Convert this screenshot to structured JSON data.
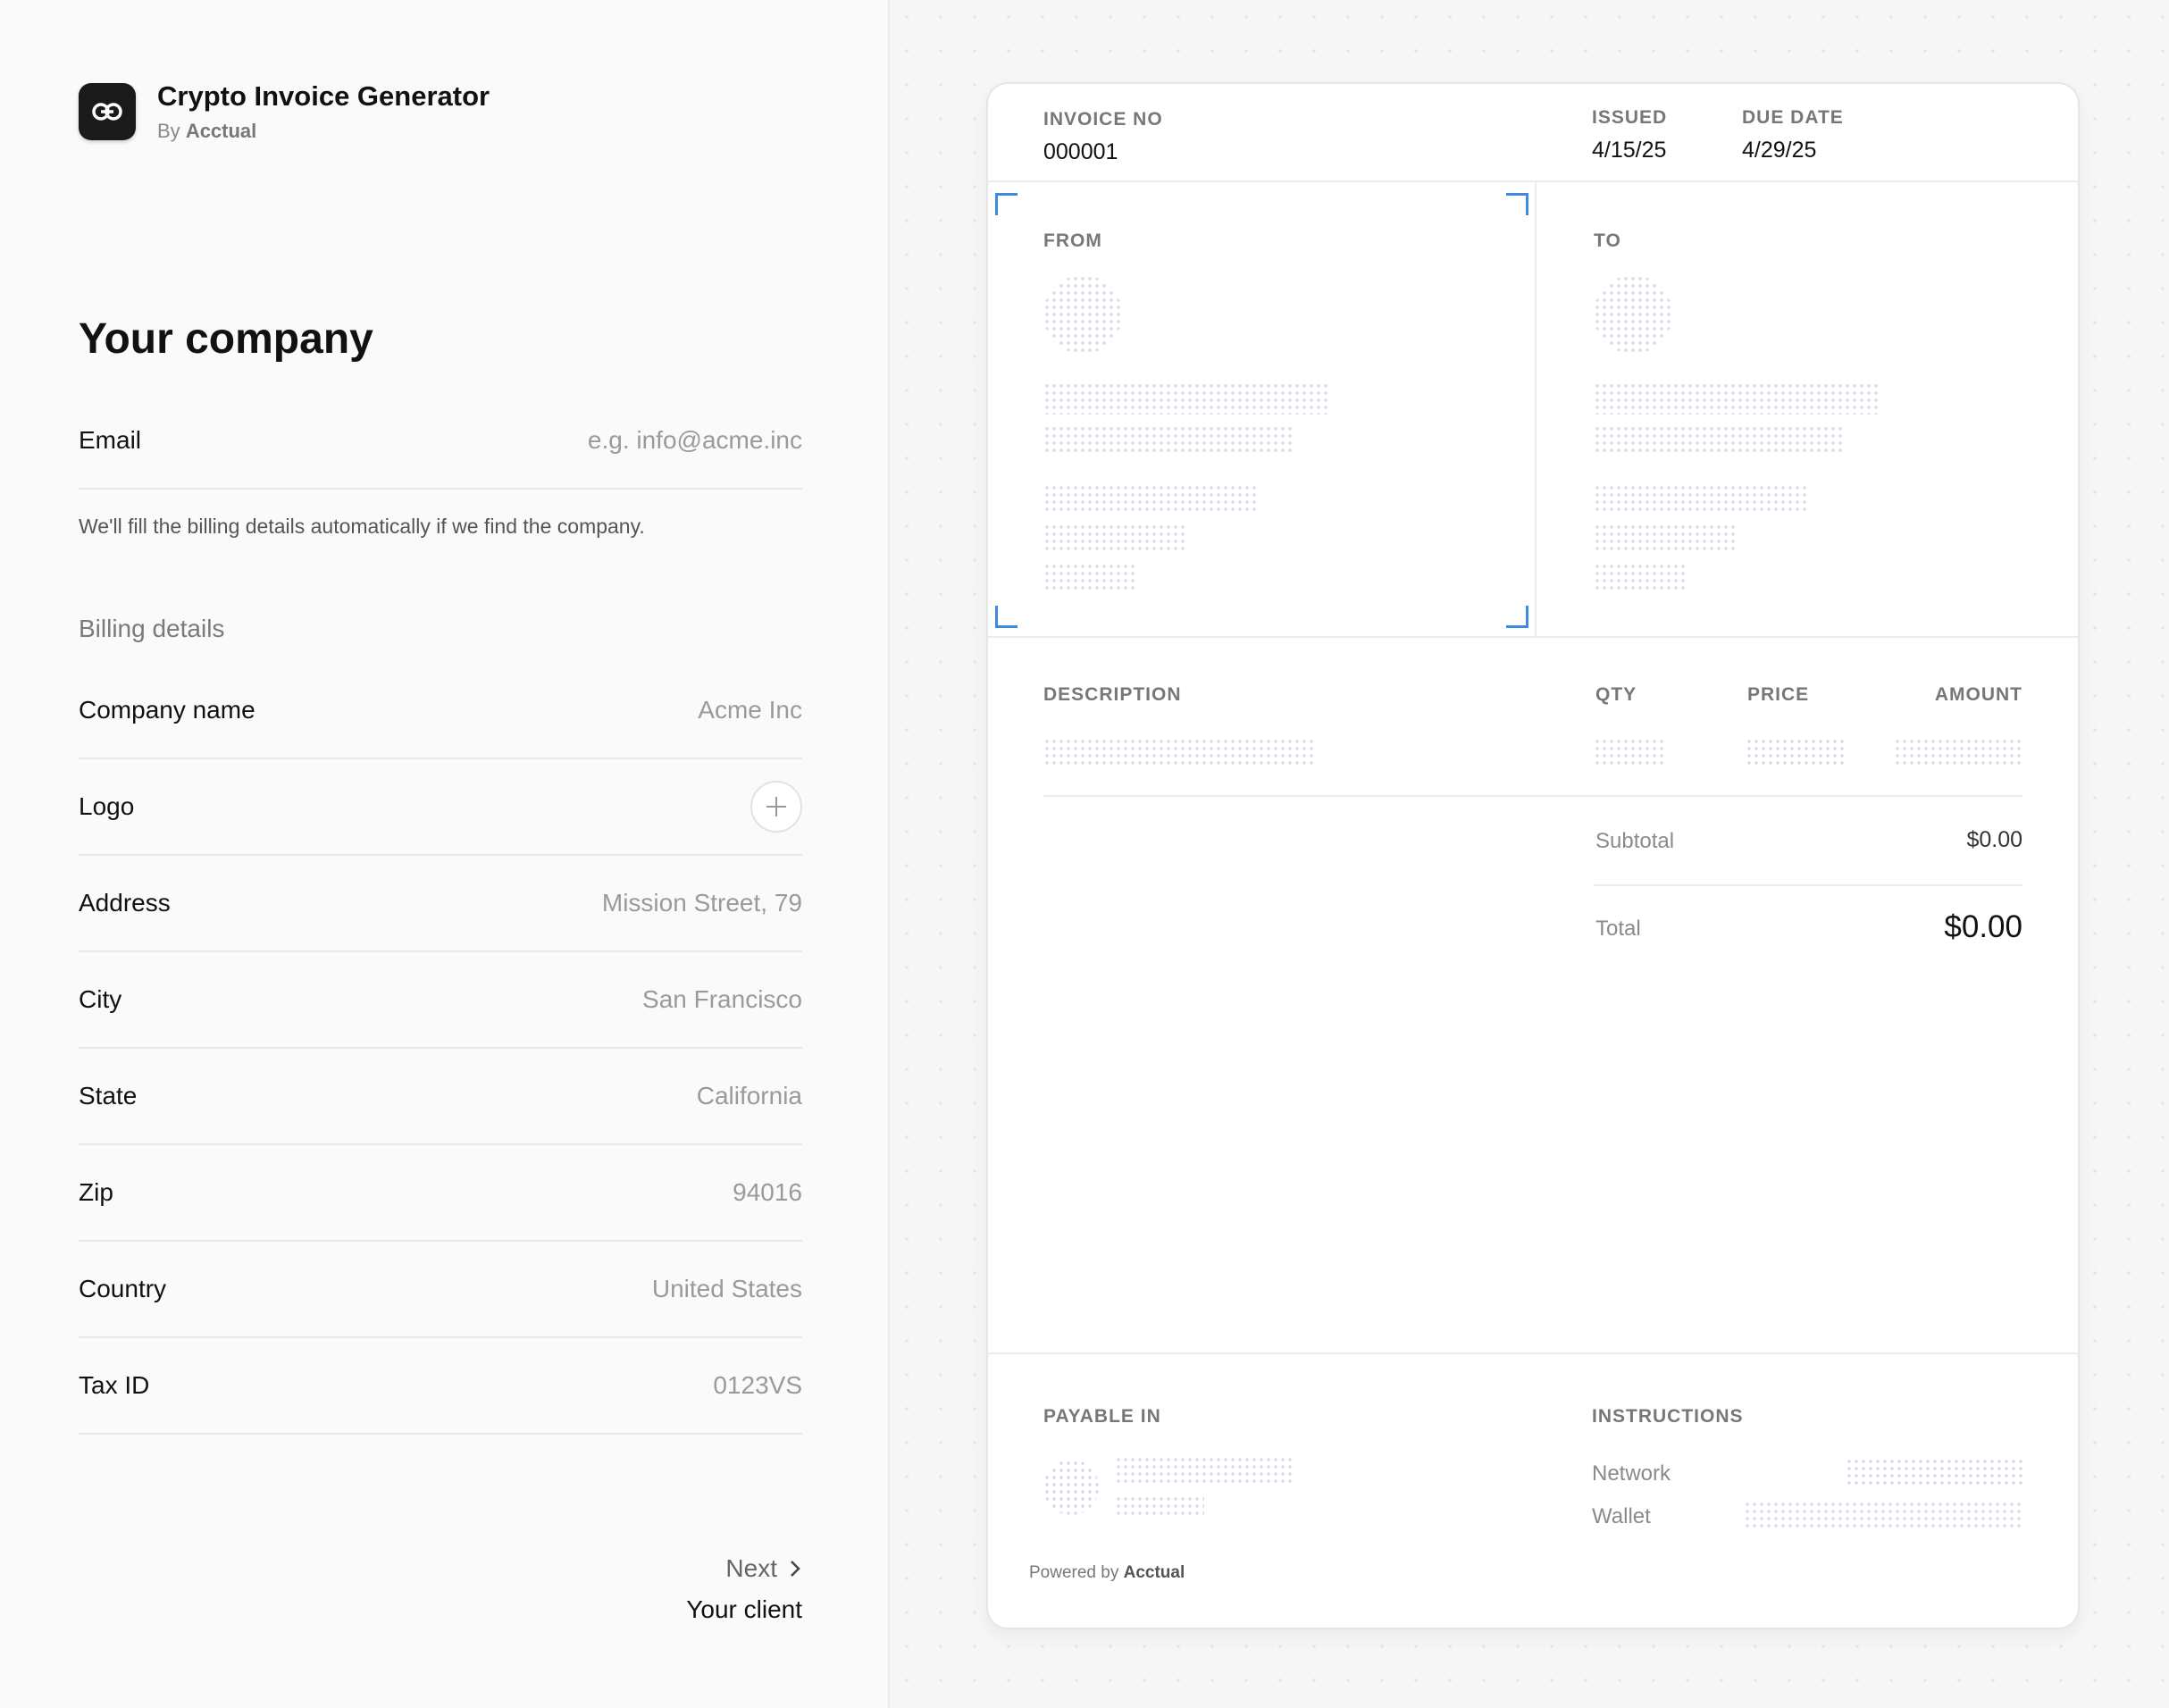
{
  "brand": {
    "title": "Crypto Invoice Generator",
    "by": "By",
    "by_name": "Acctual"
  },
  "form": {
    "section_title": "Your company",
    "email": {
      "label": "Email",
      "placeholder": "e.g. info@acme.inc"
    },
    "hint": "We'll fill the billing details automatically if we find the company.",
    "billing_title": "Billing details",
    "fields": [
      {
        "label": "Company name",
        "placeholder": "Acme Inc"
      },
      {
        "label": "Logo",
        "placeholder": ""
      },
      {
        "label": "Address",
        "placeholder": "Mission Street, 79"
      },
      {
        "label": "City",
        "placeholder": "San Francisco"
      },
      {
        "label": "State",
        "placeholder": "California"
      },
      {
        "label": "Zip",
        "placeholder": "94016"
      },
      {
        "label": "Country",
        "placeholder": "United States"
      },
      {
        "label": "Tax ID",
        "placeholder": "0123VS"
      }
    ],
    "next": {
      "label": "Next",
      "sub": "Your client"
    }
  },
  "invoice": {
    "no_label": "INVOICE NO",
    "no_value": "000001",
    "issued_label": "ISSUED",
    "issued_value": "4/15/25",
    "due_label": "DUE DATE",
    "due_value": "4/29/25",
    "from_label": "FROM",
    "to_label": "TO",
    "columns": {
      "description": "DESCRIPTION",
      "qty": "QTY",
      "price": "PRICE",
      "amount": "AMOUNT"
    },
    "subtotal_label": "Subtotal",
    "subtotal_value": "$0.00",
    "total_label": "Total",
    "total_value": "$0.00",
    "payable_label": "PAYABLE IN",
    "instructions_label": "INSTRUCTIONS",
    "network_label": "Network",
    "wallet_label": "Wallet",
    "powered_by": "Powered by",
    "powered_name": "Acctual"
  },
  "colors": {
    "accent": "#3d8be0",
    "placeholder_dots": "#cfd8e6"
  }
}
